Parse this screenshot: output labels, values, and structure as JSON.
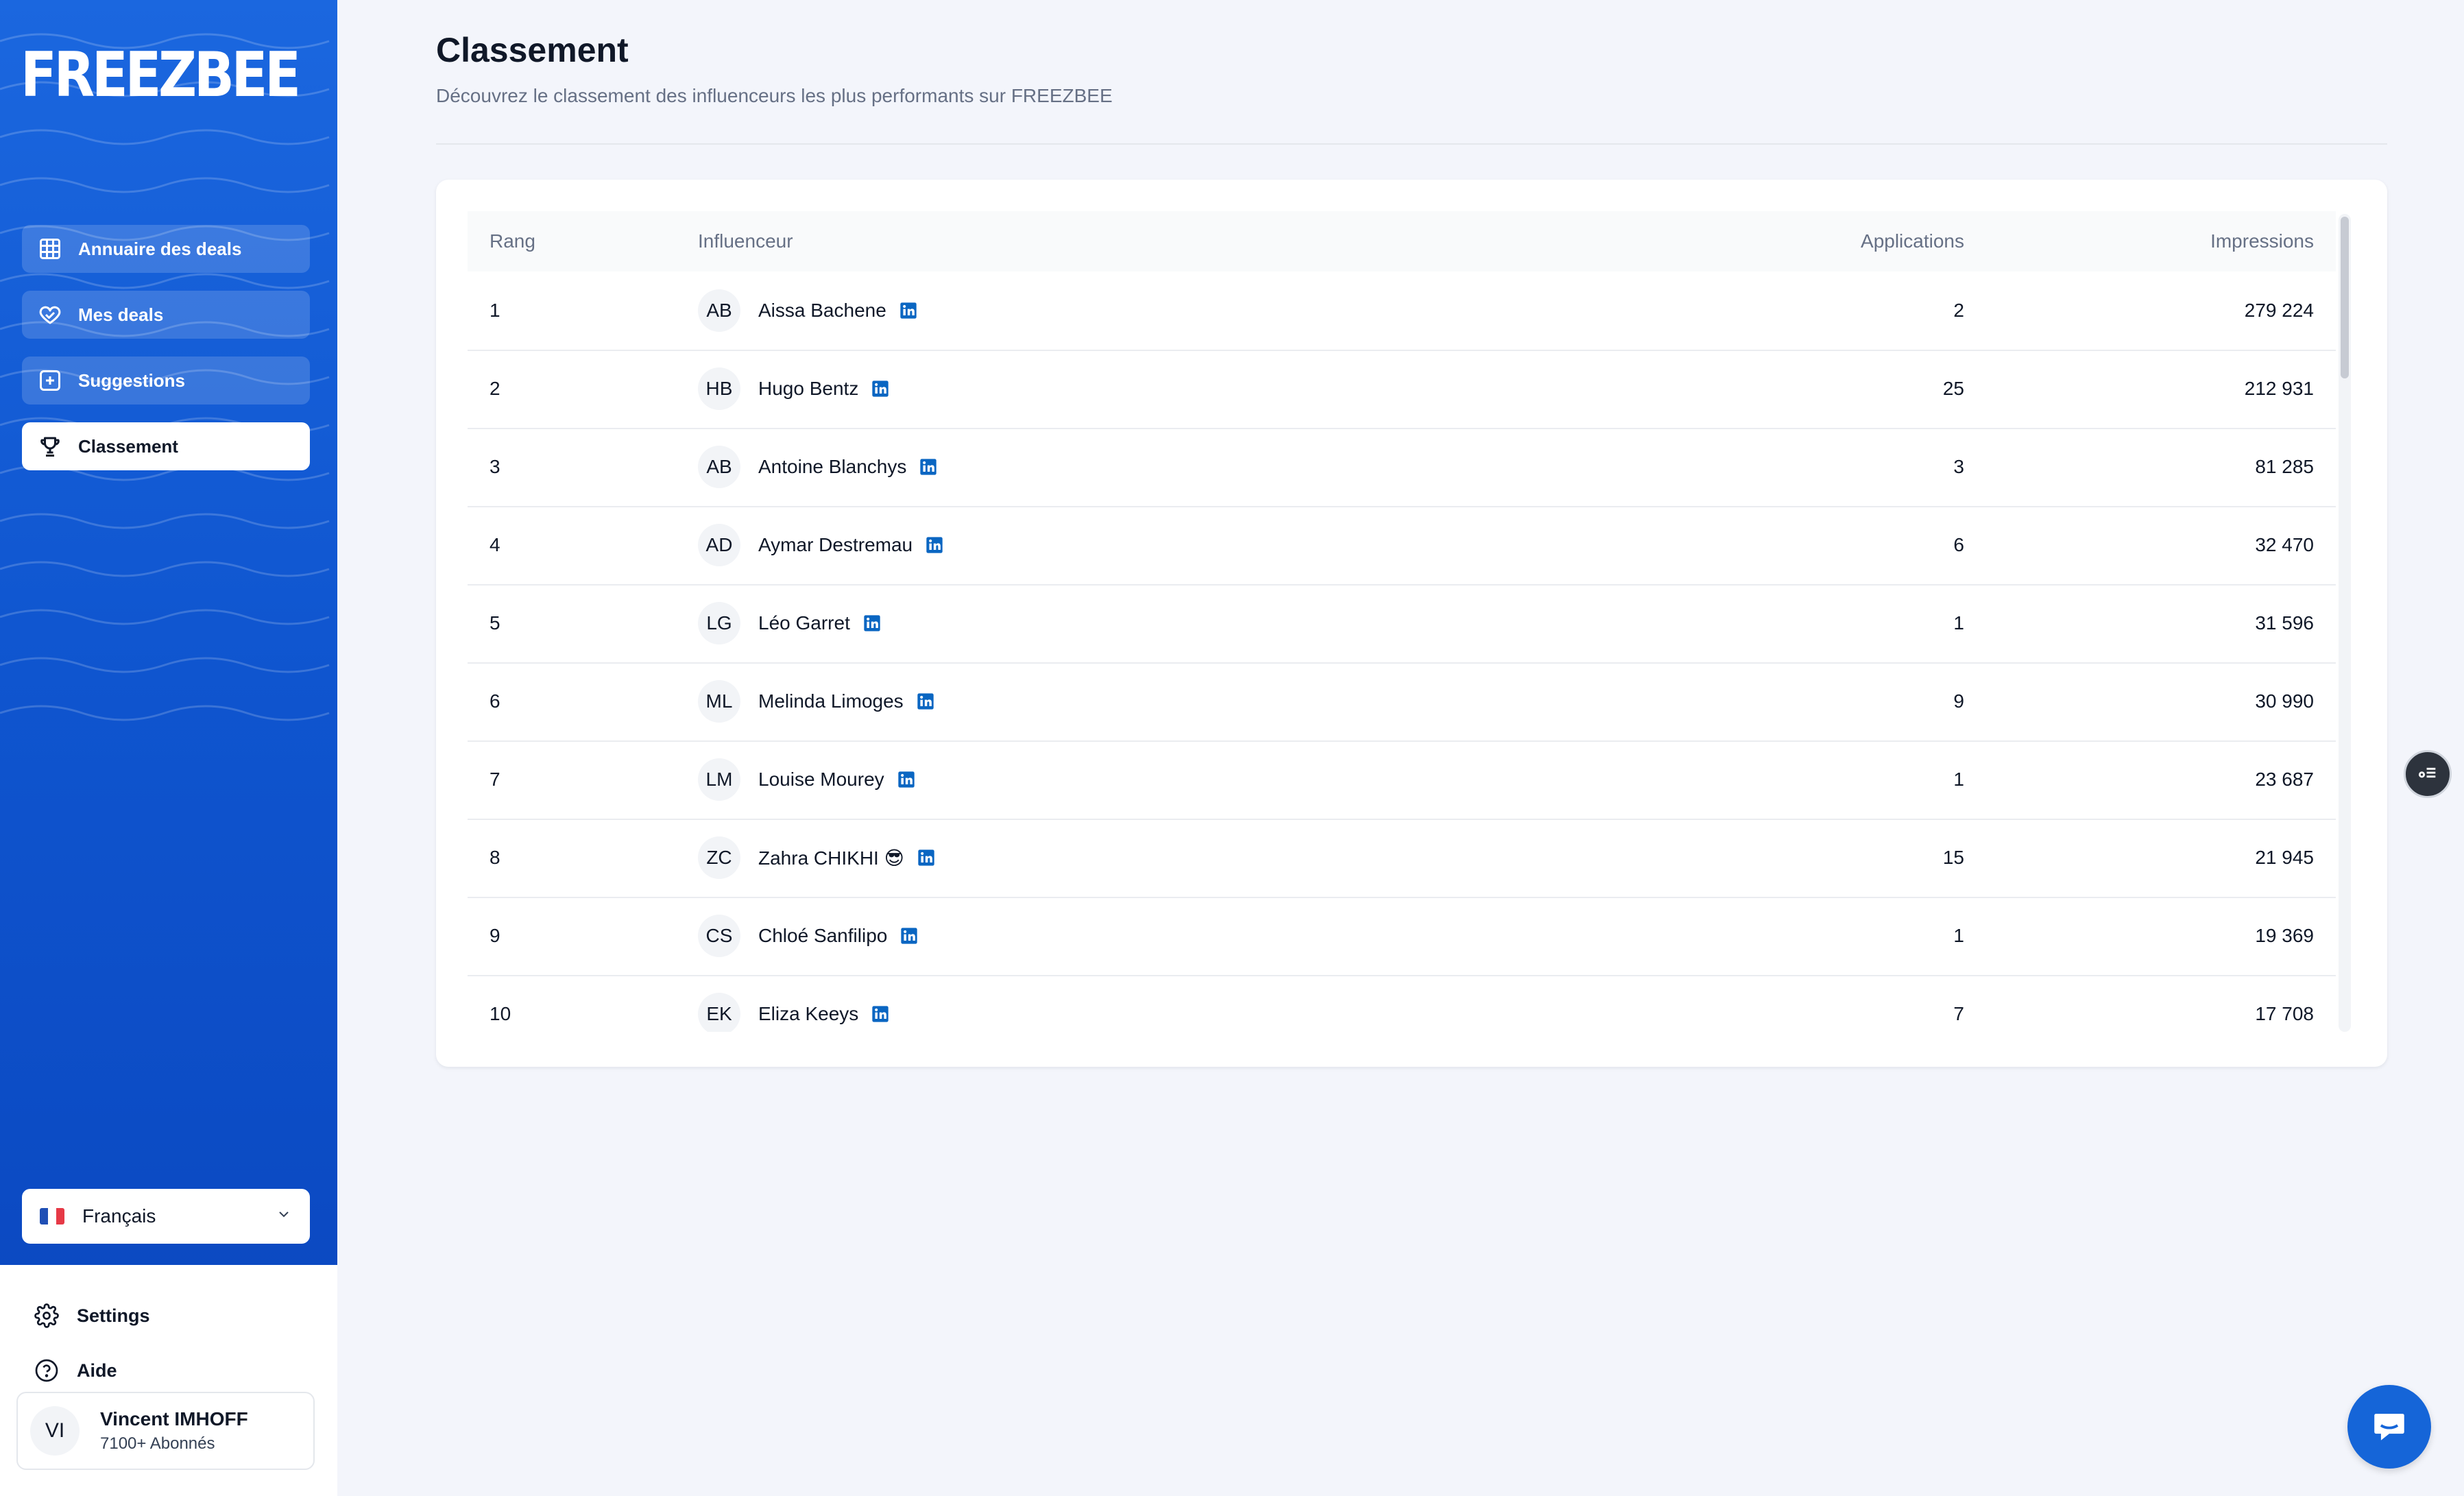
{
  "brand": {
    "logo_text": "FREEZBEE",
    "primary_color": "#1565d8"
  },
  "sidebar": {
    "items": [
      {
        "label": "Annuaire des deals",
        "icon": "grid-icon",
        "active": false
      },
      {
        "label": "Mes deals",
        "icon": "heart-handshake-icon",
        "active": false
      },
      {
        "label": "Suggestions",
        "icon": "plus-square-icon",
        "active": false
      },
      {
        "label": "Classement",
        "icon": "trophy-icon",
        "active": true
      }
    ],
    "language": {
      "selected": "Français",
      "flag": "france-flag"
    },
    "bottom_links": [
      {
        "label": "Settings",
        "icon": "gear-icon"
      },
      {
        "label": "Aide",
        "icon": "help-circle-icon"
      }
    ],
    "user": {
      "initials": "VI",
      "name": "Vincent IMHOFF",
      "subtitle": "7100+ Abonnés"
    }
  },
  "main": {
    "title": "Classement",
    "subtitle": "Découvrez le classement des influenceurs les plus performants sur FREEZBEE",
    "table": {
      "headers": {
        "rank": "Rang",
        "influencer": "Influenceur",
        "applications": "Applications",
        "impressions": "Impressions"
      },
      "rows": [
        {
          "rank": "1",
          "initials": "AB",
          "name": "Aissa Bachene",
          "applications": "2",
          "impressions": "279 224"
        },
        {
          "rank": "2",
          "initials": "HB",
          "name": "Hugo Bentz",
          "applications": "25",
          "impressions": "212 931"
        },
        {
          "rank": "3",
          "initials": "AB",
          "name": "Antoine Blanchys",
          "applications": "3",
          "impressions": "81 285"
        },
        {
          "rank": "4",
          "initials": "AD",
          "name": "Aymar Destremau",
          "applications": "6",
          "impressions": "32 470"
        },
        {
          "rank": "5",
          "initials": "LG",
          "name": "Léo Garret",
          "applications": "1",
          "impressions": "31 596"
        },
        {
          "rank": "6",
          "initials": "ML",
          "name": "Melinda Limoges",
          "applications": "9",
          "impressions": "30 990"
        },
        {
          "rank": "7",
          "initials": "LM",
          "name": "Louise Mourey",
          "applications": "1",
          "impressions": "23 687"
        },
        {
          "rank": "8",
          "initials": "ZC",
          "name": "Zahra CHIKHI 😎",
          "applications": "15",
          "impressions": "21 945"
        },
        {
          "rank": "9",
          "initials": "CS",
          "name": "Chloé Sanfilipo",
          "applications": "1",
          "impressions": "19 369"
        },
        {
          "rank": "10",
          "initials": "EK",
          "name": "Eliza Keeys",
          "applications": "7",
          "impressions": "17 708"
        }
      ]
    }
  },
  "floating": {
    "side_button_icon": "list-settings-icon",
    "chat_button_icon": "chat-bubble-icon"
  }
}
